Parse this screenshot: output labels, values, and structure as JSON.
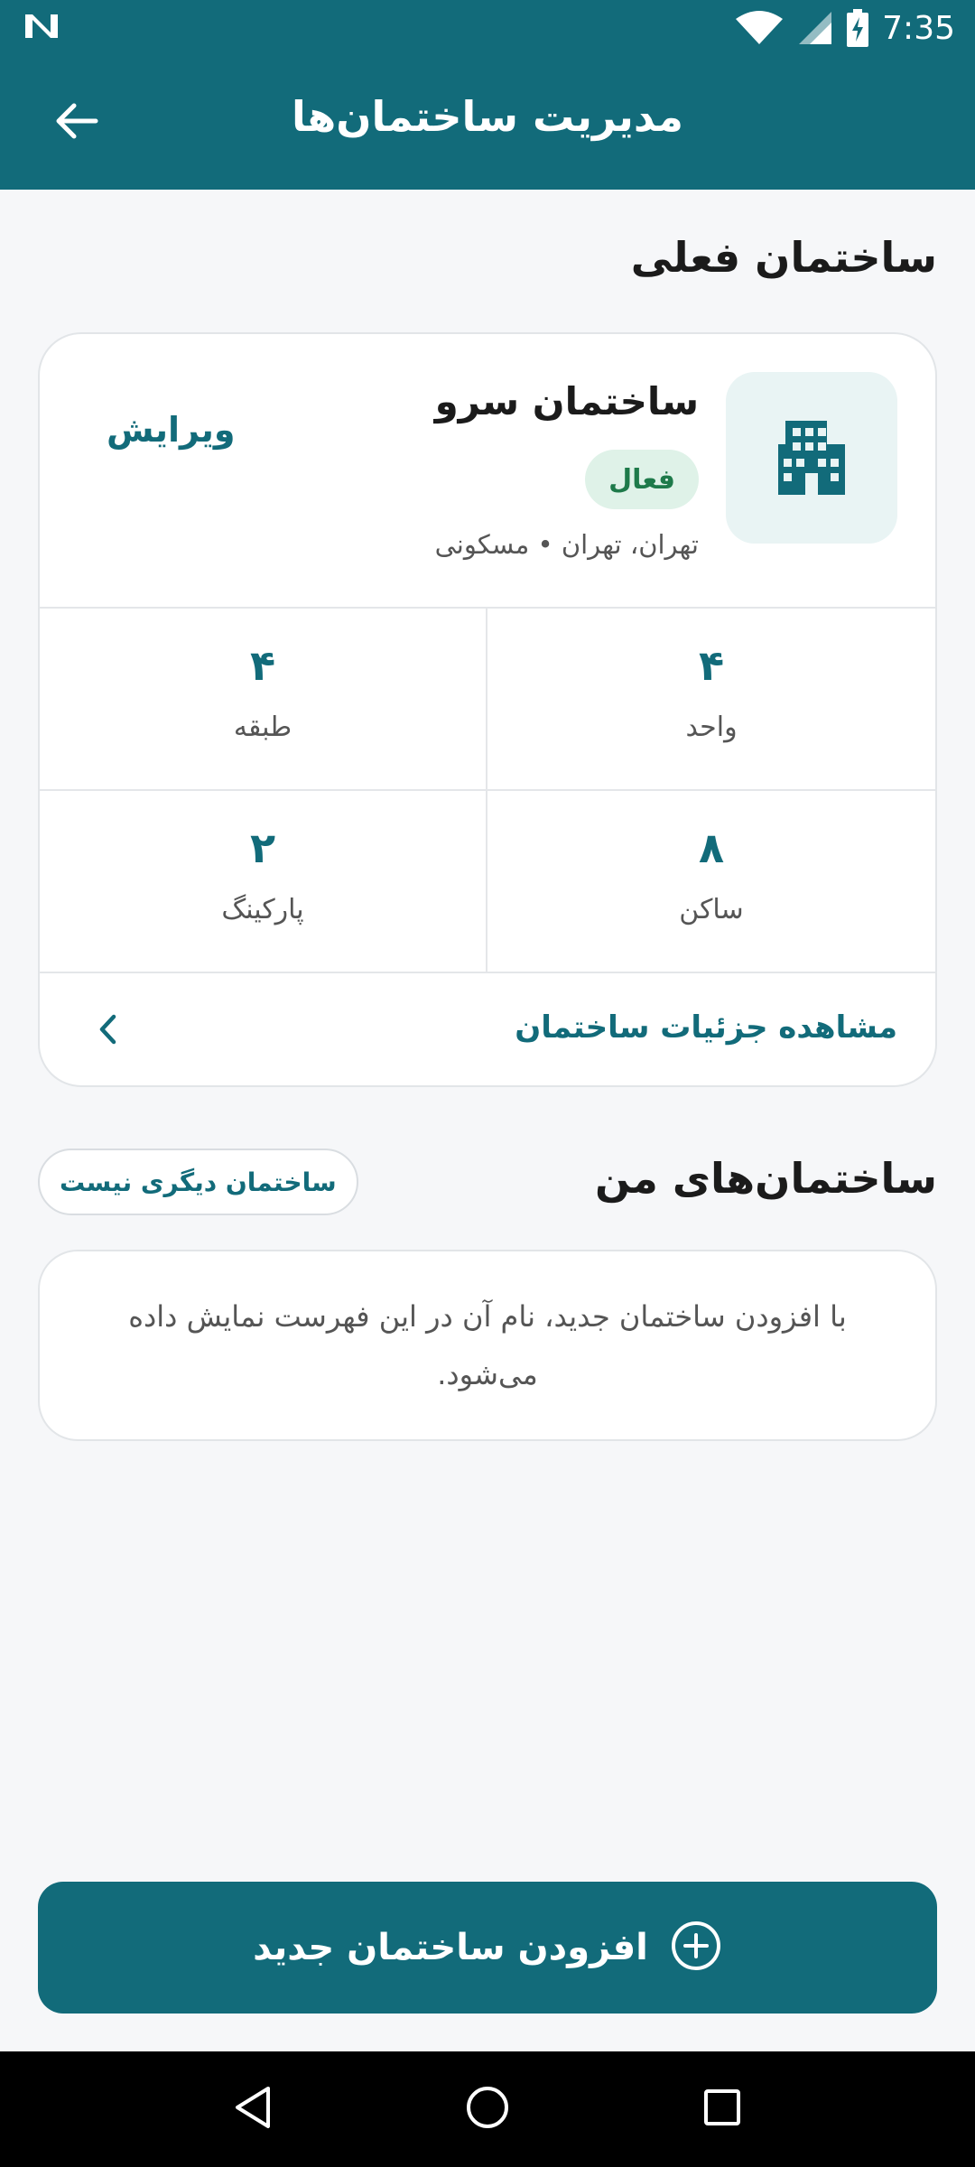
{
  "status_bar": {
    "time": "7:35",
    "icons": [
      "notification-n-icon",
      "wifi-icon",
      "signal-icon",
      "battery-charging-icon"
    ]
  },
  "app_bar": {
    "title": "مدیریت ساختمان‌ها",
    "back_icon": "arrow-left-icon"
  },
  "current_building": {
    "section_title": "ساختمان فعلی",
    "name": "ساختمان سرو",
    "status": "فعال",
    "location": "تهران، تهران • مسکونی",
    "edit_label": "ویرایش",
    "icon": "building-icon",
    "stats": {
      "units": {
        "value": "۴",
        "label": "واحد"
      },
      "floors": {
        "value": "۴",
        "label": "طبقه"
      },
      "residents": {
        "value": "۸",
        "label": "ساکن"
      },
      "parking": {
        "value": "۲",
        "label": "پارکینگ"
      }
    },
    "details_link": "مشاهده جزئیات ساختمان"
  },
  "my_buildings": {
    "section_title": "ساختمان‌های من",
    "badge": "ساختمان دیگری نیست",
    "empty_message": "با افزودن ساختمان جدید، نام آن در این فهرست نمایش داده می‌شود."
  },
  "add_button": {
    "label": "افزودن ساختمان جدید",
    "icon": "plus-circle-icon"
  },
  "colors": {
    "primary": "#126b7a",
    "active_badge_bg": "#dff2e8",
    "active_badge_text": "#1e7a4a",
    "background": "#f6f7f9"
  }
}
